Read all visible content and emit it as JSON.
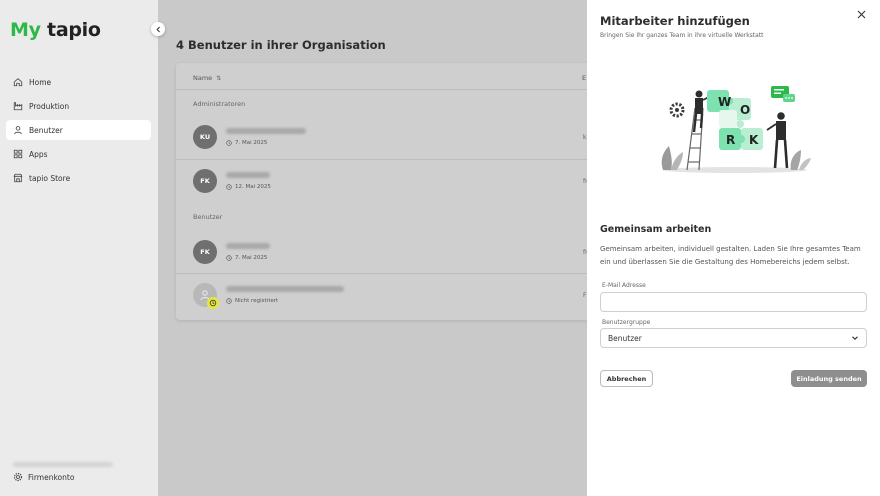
{
  "logo": {
    "my": "My",
    "tapio": "tapio"
  },
  "sidebar": {
    "items": [
      {
        "label": "Home",
        "icon": "home-icon",
        "active": false
      },
      {
        "label": "Produktion",
        "icon": "factory-icon",
        "active": false
      },
      {
        "label": "Benutzer",
        "icon": "user-icon",
        "active": true
      },
      {
        "label": "Apps",
        "icon": "apps-grid-icon",
        "active": false
      },
      {
        "label": "tapio Store",
        "icon": "store-icon",
        "active": false
      }
    ],
    "footer_label": "Firmenkonto"
  },
  "main": {
    "title": "4 Benutzer in ihrer Organisation",
    "columns": {
      "name": "Name",
      "second": "E"
    },
    "groups": {
      "admins": "Administratoren",
      "users": "Benutzer"
    },
    "rows": [
      {
        "initials": "KU",
        "date": "7. Mai 2025",
        "col2": "k"
      },
      {
        "initials": "FK",
        "date": "12. Mai 2025",
        "col2": "fr"
      },
      {
        "initials": "FK",
        "date": "7. Mai 2025",
        "col2": "fr"
      },
      {
        "initials": "",
        "date": "Nicht registriert",
        "col2": "F"
      }
    ]
  },
  "panel": {
    "title": "Mitarbeiter hinzufügen",
    "subtitle": "Bringen Sie Ihr ganzes Team in ihre virtuelle Werkstatt",
    "illustration_letters": [
      "W",
      "O",
      "R",
      "K"
    ],
    "section_title": "Gemeinsam arbeiten",
    "section_text": "Gemeinsam arbeiten, individuell gestalten. Laden Sie Ihre gesamtes Team ein und überlassen Sie die Gestaltung des Homebereichs jedem selbst.",
    "email_label": "E-Mail Adresse",
    "email_value": "",
    "group_label": "Benutzergruppe",
    "group_value": "Benutzer",
    "cancel_label": "Abbrechen",
    "send_label": "Einladung senden"
  },
  "colors": {
    "brand_green": "#2db84a",
    "accent_green": "#7de2b0",
    "badge_yellow": "#e5e83a"
  }
}
